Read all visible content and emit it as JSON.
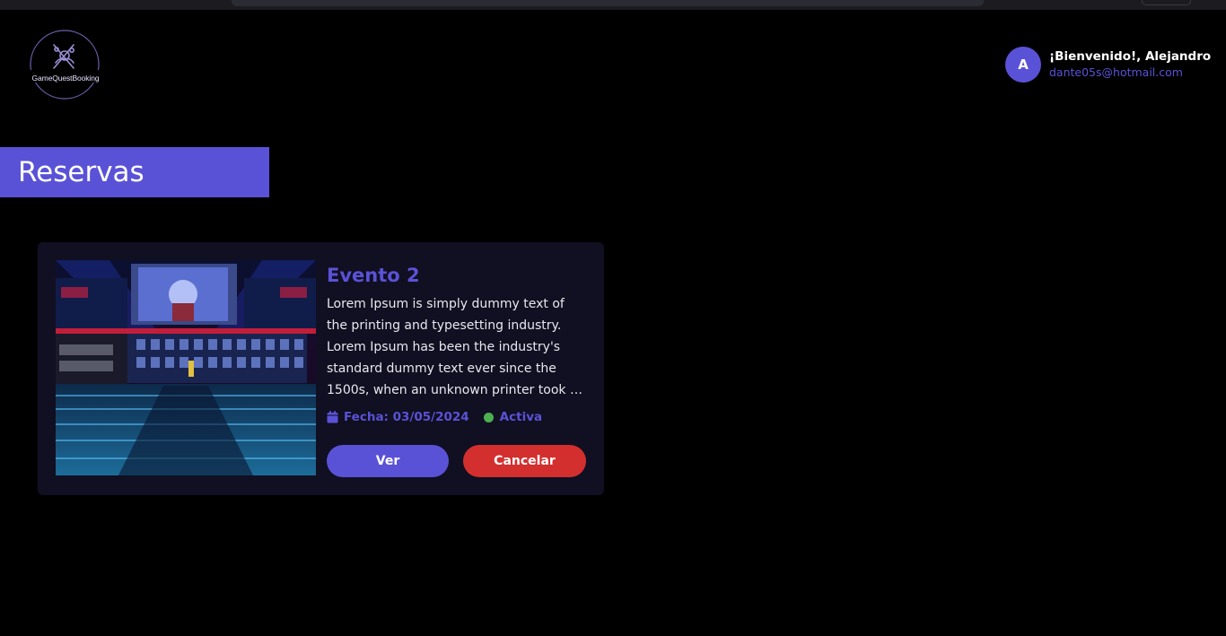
{
  "app": {
    "logo_text": "GameQuestBooking"
  },
  "user": {
    "initial": "A",
    "greeting": "¡Bienvenido!, Alejandro",
    "email": "dante05s@hotmail.com"
  },
  "page": {
    "title": "Reservas"
  },
  "reservations": [
    {
      "title": "Evento 2",
      "description": "Lorem Ipsum is simply dummy text of the printing and typesetting industry. Lorem Ipsum has been the industry's standard dummy text ever since the 1500s, when an unknown printer took a galley of type and scrambled it to make a type specimen book.",
      "date_label": "Fecha: 03/05/2024",
      "status": "Activa",
      "view_label": "Ver",
      "cancel_label": "Cancelar"
    }
  ],
  "colors": {
    "accent": "#5a52d6",
    "danger": "#d32f2f",
    "status_active": "#4caf50",
    "background": "#000000",
    "card": "#110f22"
  },
  "icons": [
    "logo-gamepad-icon",
    "calendar-icon",
    "status-dot-icon"
  ]
}
